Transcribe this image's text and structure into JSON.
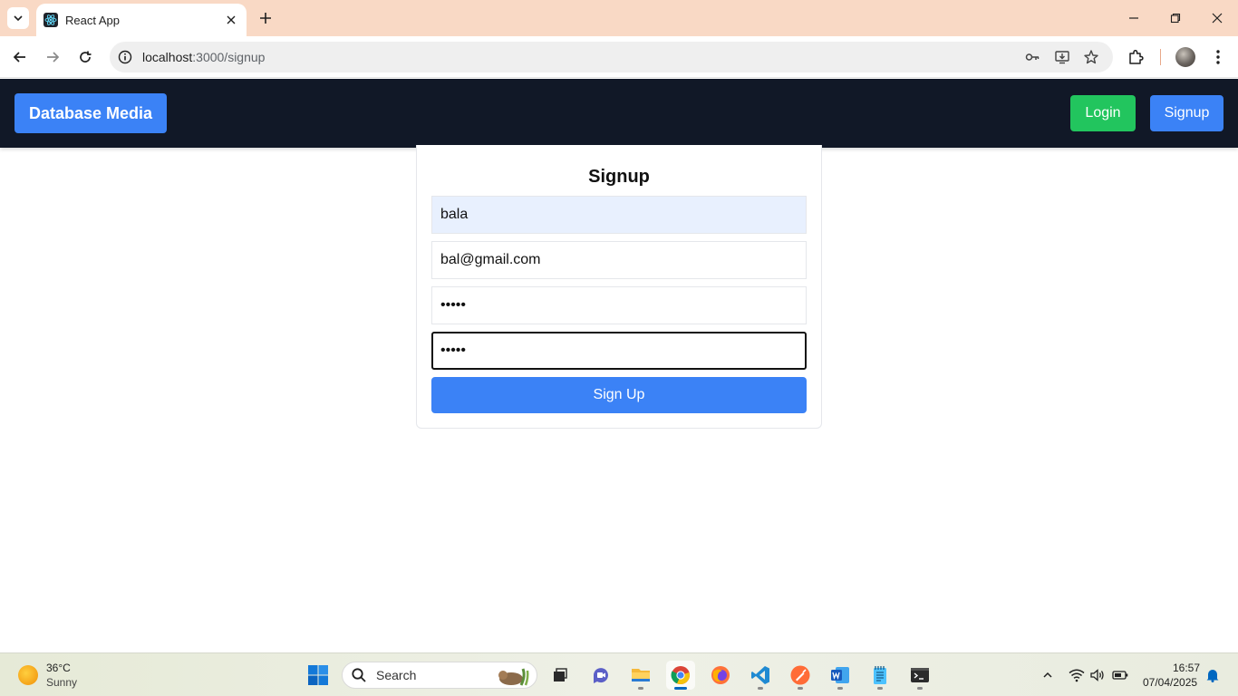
{
  "browser": {
    "tab_title": "React App",
    "url_host": "localhost",
    "url_path": ":3000/signup"
  },
  "navbar": {
    "brand": "Database Media",
    "login_label": "Login",
    "signup_label": "Signup"
  },
  "form": {
    "title": "Signup",
    "username_value": "bala",
    "email_value": "bal@gmail.com",
    "password_value": "•••••",
    "confirm_password_value": "•••••",
    "submit_label": "Sign Up"
  },
  "taskbar": {
    "weather_temp": "36°C",
    "weather_desc": "Sunny",
    "search_label": "Search",
    "time": "16:57",
    "date": "07/04/2025"
  },
  "colors": {
    "navbar_bg": "#111827",
    "primary_blue": "#3b82f6",
    "login_green": "#22c55e",
    "tabstrip": "#f9d9c5",
    "autofill": "#e8f0fe"
  }
}
